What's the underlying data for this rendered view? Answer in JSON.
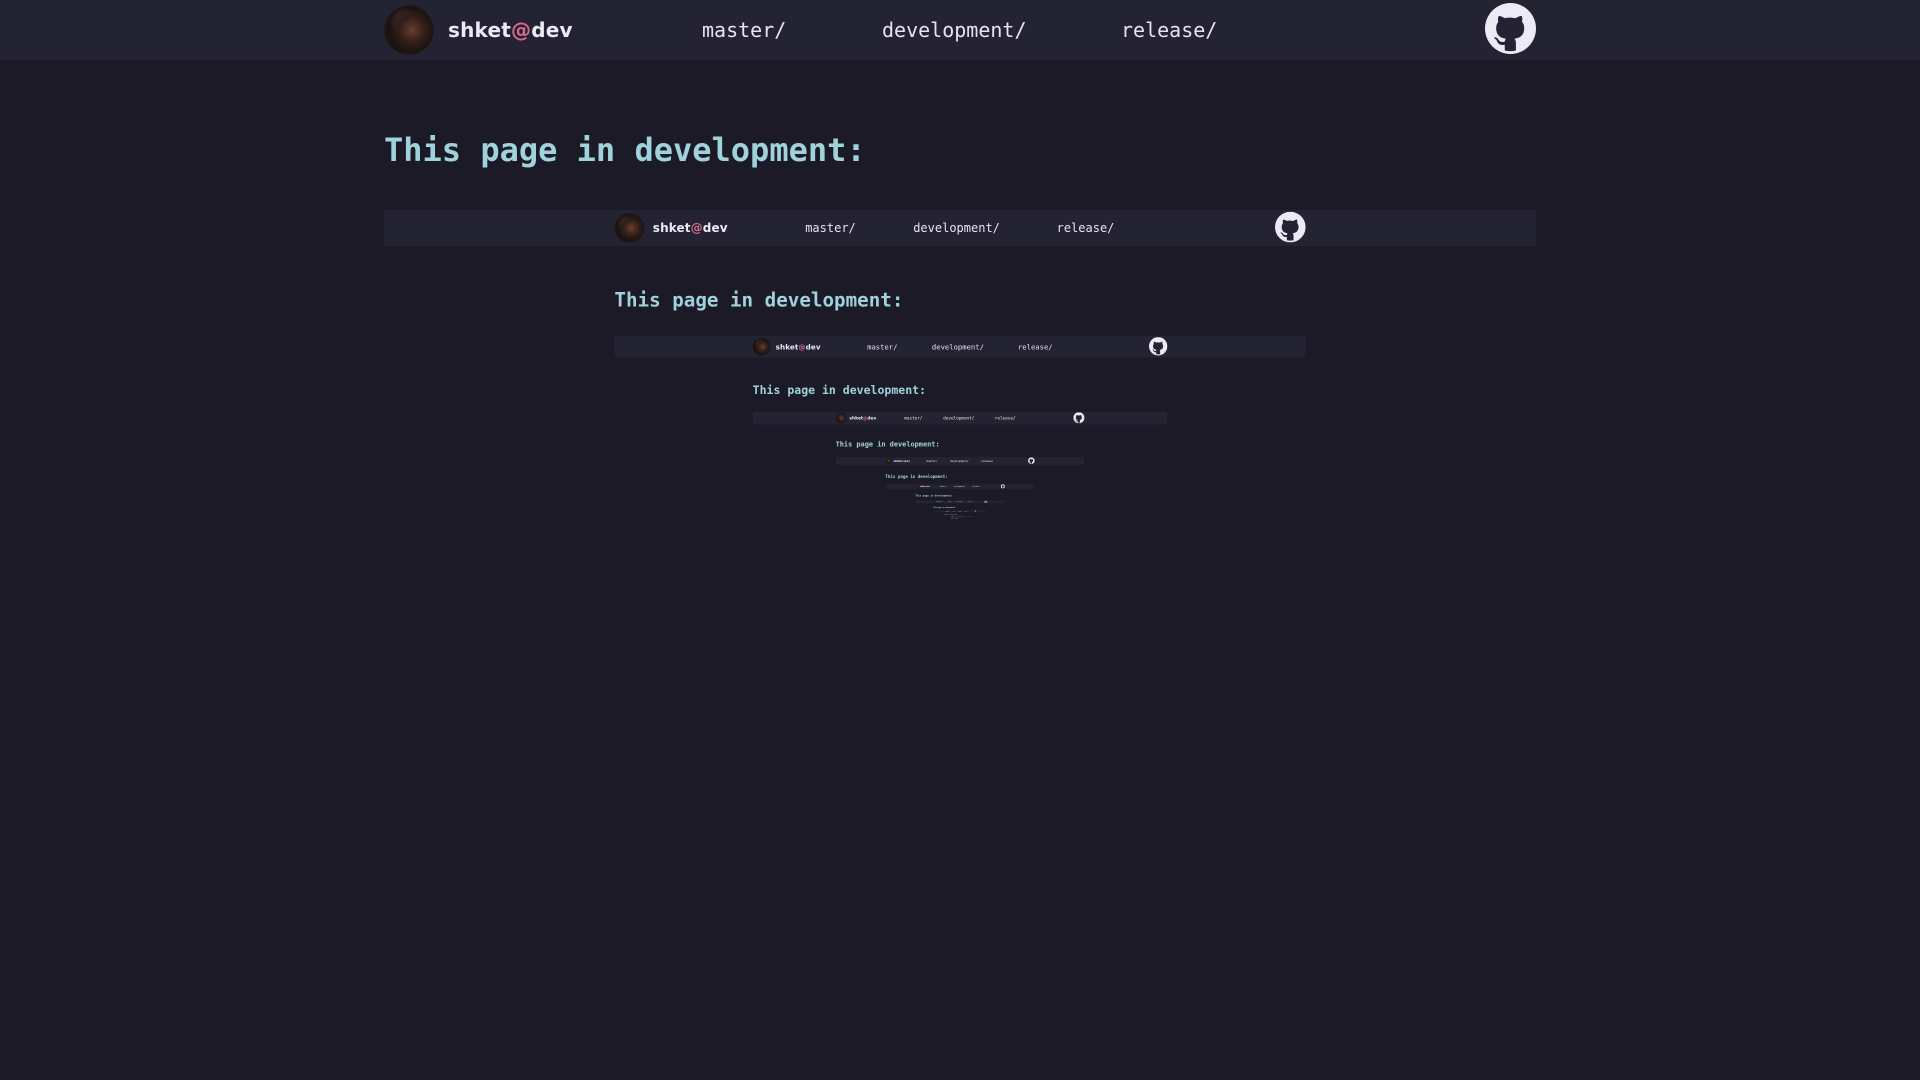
{
  "site": {
    "brand": {
      "name": "shket",
      "at": "@",
      "suffix": "dev"
    },
    "nav": {
      "master": "master/",
      "development": "development/",
      "release": "release/"
    },
    "icons": {
      "avatar": "avatar",
      "github": "github-icon"
    },
    "heading": "This page in development:"
  },
  "recursion_levels": 9,
  "colors": {
    "background": "#1b1a26",
    "navbar": "#242333",
    "heading": "#9fd2da",
    "nav_text": "#e6e4ee",
    "at_accent": "#d86a8a"
  }
}
